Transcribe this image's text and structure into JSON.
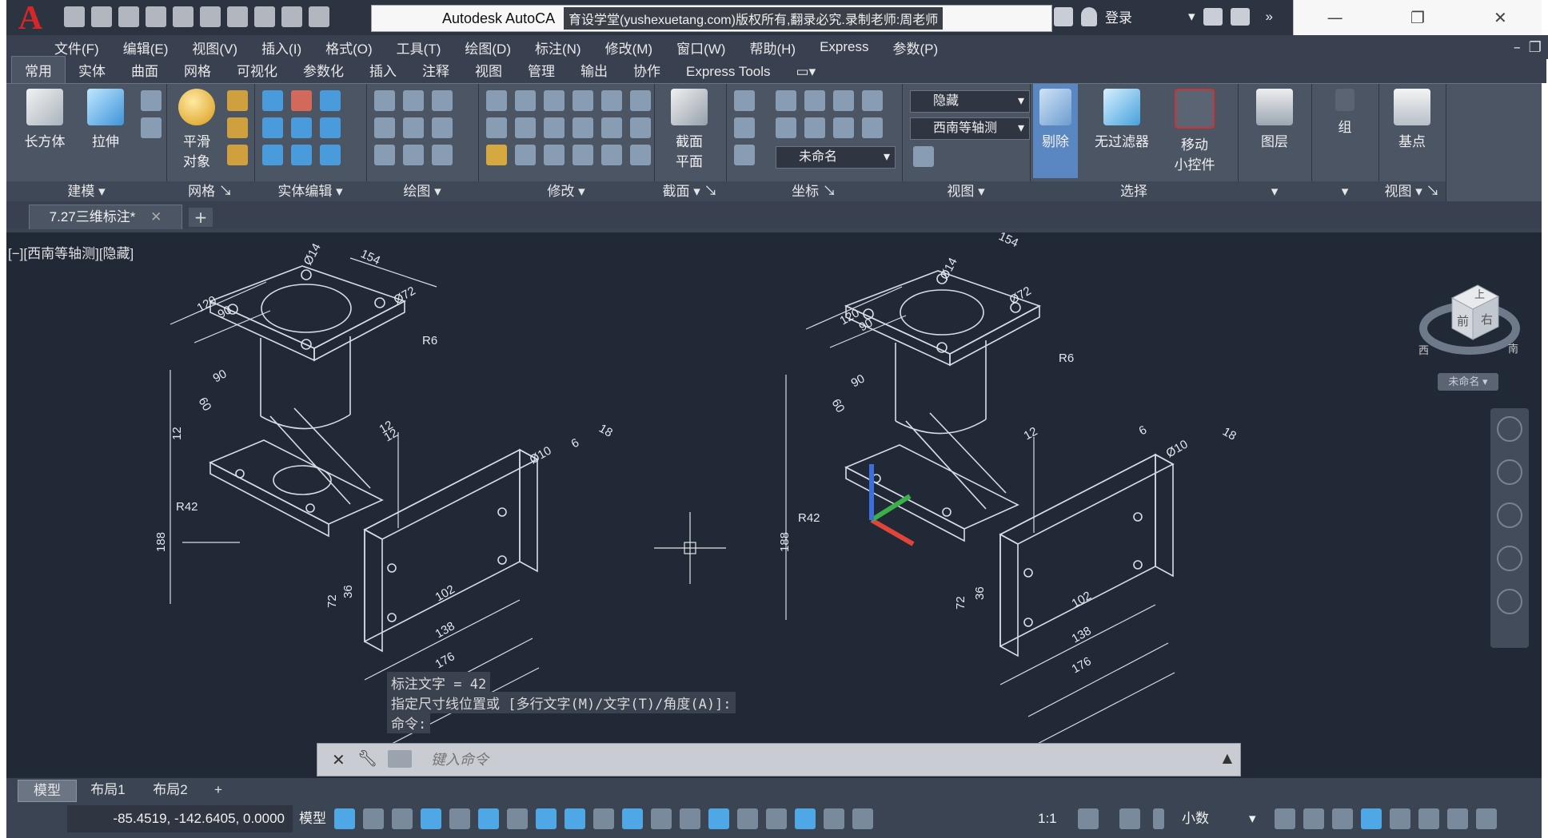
{
  "title": {
    "app_title": "Autodesk AutoCA",
    "watermark": "育设学堂(yushexuetang.com)版权所有,翻录必究.录制老师:周老师",
    "login": "登录"
  },
  "menu": [
    "文件(F)",
    "编辑(E)",
    "视图(V)",
    "插入(I)",
    "格式(O)",
    "工具(T)",
    "绘图(D)",
    "标注(N)",
    "修改(M)",
    "窗口(W)",
    "帮助(H)",
    "Express",
    "参数(P)"
  ],
  "ribbon_tabs": [
    "常用",
    "实体",
    "曲面",
    "网格",
    "可视化",
    "参数化",
    "插入",
    "注释",
    "视图",
    "管理",
    "输出",
    "协作",
    "Express Tools"
  ],
  "ribbon": {
    "box_label": "长方体",
    "extrude_label": "拉伸",
    "smooth_label_1": "平滑",
    "smooth_label_2": "对象",
    "section_label_1": "截面",
    "section_label_2": "平面",
    "hide_dropdown": "隐藏",
    "view_dropdown": "西南等轴测",
    "ucs_dropdown": "未命名",
    "cull_label": "剔除",
    "filter_label": "无过滤器",
    "gizmo_label_1": "移动",
    "gizmo_label_2": "小控件",
    "layer_label": "图层",
    "group_label": "组",
    "base_label": "基点",
    "panels": {
      "modeling": "建模",
      "mesh": "网格",
      "solid_edit": "实体编辑",
      "draw": "绘图",
      "modify": "修改",
      "section": "截面",
      "coordinates": "坐标",
      "view": "视图",
      "selection": "选择",
      "view2": "视图"
    }
  },
  "document_tab": "7.27三维标注*",
  "viewport": {
    "label": "[−][西南等轴测][隐藏]",
    "viewcube_top": "上",
    "viewcube_front": "前",
    "viewcube_right": "右",
    "viewcube_west": "西",
    "viewcube_south": "南",
    "ucs_name": "未命名"
  },
  "dimensions": {
    "left": [
      "154",
      "Ø14",
      "Ø72",
      "120",
      "90",
      "R6",
      "90",
      "60",
      "12",
      "R42",
      "12",
      "188",
      "Ø10",
      "6",
      "18",
      "12",
      "72",
      "36",
      "102",
      "138",
      "176"
    ],
    "right": [
      "154",
      "Ø14",
      "Ø72",
      "120",
      "90",
      "R6",
      "90",
      "60",
      "12",
      "R42",
      "188",
      "Ø10",
      "6",
      "18",
      "72",
      "36",
      "102",
      "138",
      "176"
    ]
  },
  "command": {
    "history": [
      "标注文字 = 42",
      "指定尺寸线位置或 [多行文字(M)/文字(T)/角度(A)]:",
      "命令:"
    ],
    "placeholder": "键入命令"
  },
  "layout_tabs": [
    "模型",
    "布局1",
    "布局2"
  ],
  "status": {
    "coords": "-85.4519, -142.6405, 0.0000",
    "model": "模型",
    "scale": "1:1",
    "units": "小数"
  },
  "colors": {
    "background": "#212836",
    "linework": "#d8dde4",
    "ucs_x": "#e0453a",
    "ucs_y": "#3bb04a",
    "ucs_z": "#3b6fe0"
  }
}
